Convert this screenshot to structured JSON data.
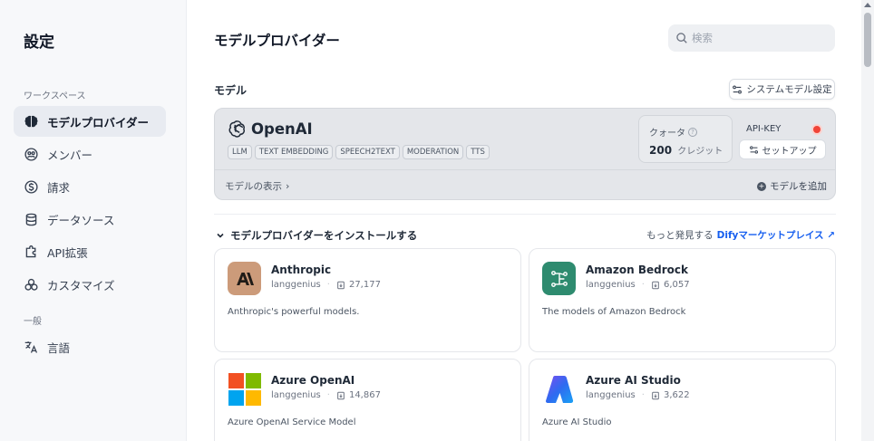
{
  "sidebar": {
    "title": "設定",
    "sections": [
      {
        "label": "ワークスペース"
      },
      {
        "label": "一般"
      }
    ],
    "items": [
      {
        "label": "モデルプロバイダー",
        "icon": "brain-icon",
        "active": true
      },
      {
        "label": "メンバー",
        "icon": "members-icon"
      },
      {
        "label": "請求",
        "icon": "billing-icon"
      },
      {
        "label": "データソース",
        "icon": "database-icon"
      },
      {
        "label": "API拡張",
        "icon": "puzzle-icon"
      },
      {
        "label": "カスタマイズ",
        "icon": "customize-icon"
      },
      {
        "label": "言語",
        "icon": "translate-icon"
      }
    ]
  },
  "header": {
    "title": "モデルプロバイダー",
    "search_placeholder": "検索"
  },
  "models": {
    "label": "モデル",
    "system_settings_label": "システムモデル設定",
    "provider": {
      "name": "OpenAI",
      "tags": [
        "LLM",
        "TEXT EMBEDDING",
        "SPEECH2TEXT",
        "MODERATION",
        "TTS"
      ],
      "quota_label": "クォータ",
      "quota_value": "200",
      "quota_unit": "クレジット",
      "api_key_label": "API-KEY",
      "api_status_color": "#f04438",
      "setup_label": "セットアップ",
      "show_models_label": "モデルの表示",
      "add_model_label": "モデルを追加"
    }
  },
  "install": {
    "title": "モデルプロバイダーをインストールする",
    "more_prefix": "もっと発見する",
    "marketplace_label": "Difyマーケットプレイス ↗",
    "plugins": [
      {
        "name": "Anthropic",
        "author": "langgenius",
        "downloads": "27,177",
        "description": "Anthropic's powerful models.",
        "icon": "anthropic-logo-icon",
        "color": "#cc9b7a"
      },
      {
        "name": "Amazon Bedrock",
        "author": "langgenius",
        "downloads": "6,057",
        "description": "The models of Amazon Bedrock",
        "icon": "bedrock-logo-icon",
        "color": "#2e8b6f"
      },
      {
        "name": "Azure OpenAI",
        "author": "langgenius",
        "downloads": "14,867",
        "description": "Azure OpenAI Service Model",
        "icon": "microsoft-logo-icon",
        "color": "#ffffff"
      },
      {
        "name": "Azure AI Studio",
        "author": "langgenius",
        "downloads": "3,622",
        "description": "Azure AI Studio",
        "icon": "azure-logo-icon",
        "color": "#ffffff"
      }
    ]
  }
}
